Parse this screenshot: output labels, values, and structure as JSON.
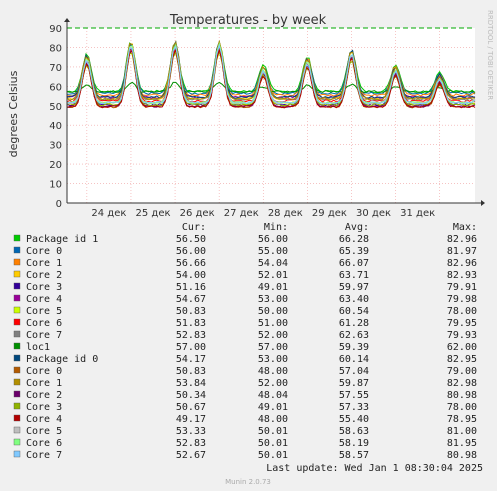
{
  "chart_data": {
    "type": "line",
    "title": "Temperatures - by week",
    "ylabel": "degrees Celsius",
    "xlabel": "",
    "ylim": [
      0,
      90
    ],
    "yticks": [
      0,
      10,
      20,
      30,
      40,
      50,
      60,
      70,
      80,
      90
    ],
    "x_ticks": [
      "24 дек",
      "25 дек",
      "26 дек",
      "27 дек",
      "28 дек",
      "29 дек",
      "30 дек",
      "31 дек"
    ],
    "warning_line": 90,
    "grid": true,
    "side_label": "RRDTOOL / TOBI OETIKER",
    "legend_headers": [
      "Cur:",
      "Min:",
      "Avg:",
      "Max:"
    ],
    "series": [
      {
        "name": "Package id 1",
        "color": "#00cc00",
        "cur": "56.50",
        "min": "56.00",
        "avg": "66.28",
        "max": "82.96"
      },
      {
        "name": "Core 0",
        "color": "#0066b3",
        "cur": "56.00",
        "min": "55.00",
        "avg": "65.39",
        "max": "81.97"
      },
      {
        "name": "Core 1",
        "color": "#ff8000",
        "cur": "56.66",
        "min": "54.04",
        "avg": "66.07",
        "max": "82.96"
      },
      {
        "name": "Core 2",
        "color": "#ffcc00",
        "cur": "54.00",
        "min": "52.01",
        "avg": "63.71",
        "max": "82.93"
      },
      {
        "name": "Core 3",
        "color": "#330099",
        "cur": "51.16",
        "min": "49.01",
        "avg": "59.97",
        "max": "79.91"
      },
      {
        "name": "Core 4",
        "color": "#990099",
        "cur": "54.67",
        "min": "53.00",
        "avg": "63.40",
        "max": "79.98"
      },
      {
        "name": "Core 5",
        "color": "#ccff00",
        "cur": "50.83",
        "min": "50.00",
        "avg": "60.54",
        "max": "78.00"
      },
      {
        "name": "Core 6",
        "color": "#ff0000",
        "cur": "51.83",
        "min": "51.00",
        "avg": "61.28",
        "max": "79.95"
      },
      {
        "name": "Core 7",
        "color": "#808080",
        "cur": "52.83",
        "cur_raw": 52.83,
        "min": "52.00",
        "avg": "62.63",
        "max": "79.93"
      },
      {
        "name": "loc1",
        "color": "#008f00",
        "cur": "57.00",
        "min": "57.00",
        "avg": "59.39",
        "max": "62.00"
      },
      {
        "name": "Package id 0",
        "color": "#00487d",
        "cur": "54.17",
        "min": "53.00",
        "avg": "60.14",
        "max": "82.95"
      },
      {
        "name": "Core 0",
        "color": "#b35a00",
        "cur": "50.83",
        "min": "48.00",
        "avg": "57.04",
        "max": "79.00"
      },
      {
        "name": "Core 1",
        "color": "#b38f00",
        "cur": "53.84",
        "min": "52.00",
        "avg": "59.87",
        "max": "82.98"
      },
      {
        "name": "Core 2",
        "color": "#6b006b",
        "cur": "50.34",
        "min": "48.04",
        "avg": "57.55",
        "max": "80.98"
      },
      {
        "name": "Core 3",
        "color": "#8fb300",
        "cur": "50.67",
        "min": "49.01",
        "avg": "57.33",
        "max": "78.00"
      },
      {
        "name": "Core 4",
        "color": "#b30000",
        "cur": "49.17",
        "min": "48.00",
        "avg": "55.40",
        "max": "78.95"
      },
      {
        "name": "Core 5",
        "color": "#bebebe",
        "cur": "53.33",
        "min": "50.01",
        "avg": "58.63",
        "max": "81.00"
      },
      {
        "name": "Core 6",
        "color": "#80ff80",
        "cur": "52.83",
        "min": "50.01",
        "avg": "58.19",
        "max": "81.95"
      },
      {
        "name": "Core 7",
        "color": "#80c9ff",
        "cur": "52.67",
        "min": "50.01",
        "avg": "58.57",
        "max": "80.98"
      }
    ],
    "last_update": "Last update: Wed Jan  1 08:30:04 2025",
    "footer": "Munin 2.0.73"
  }
}
